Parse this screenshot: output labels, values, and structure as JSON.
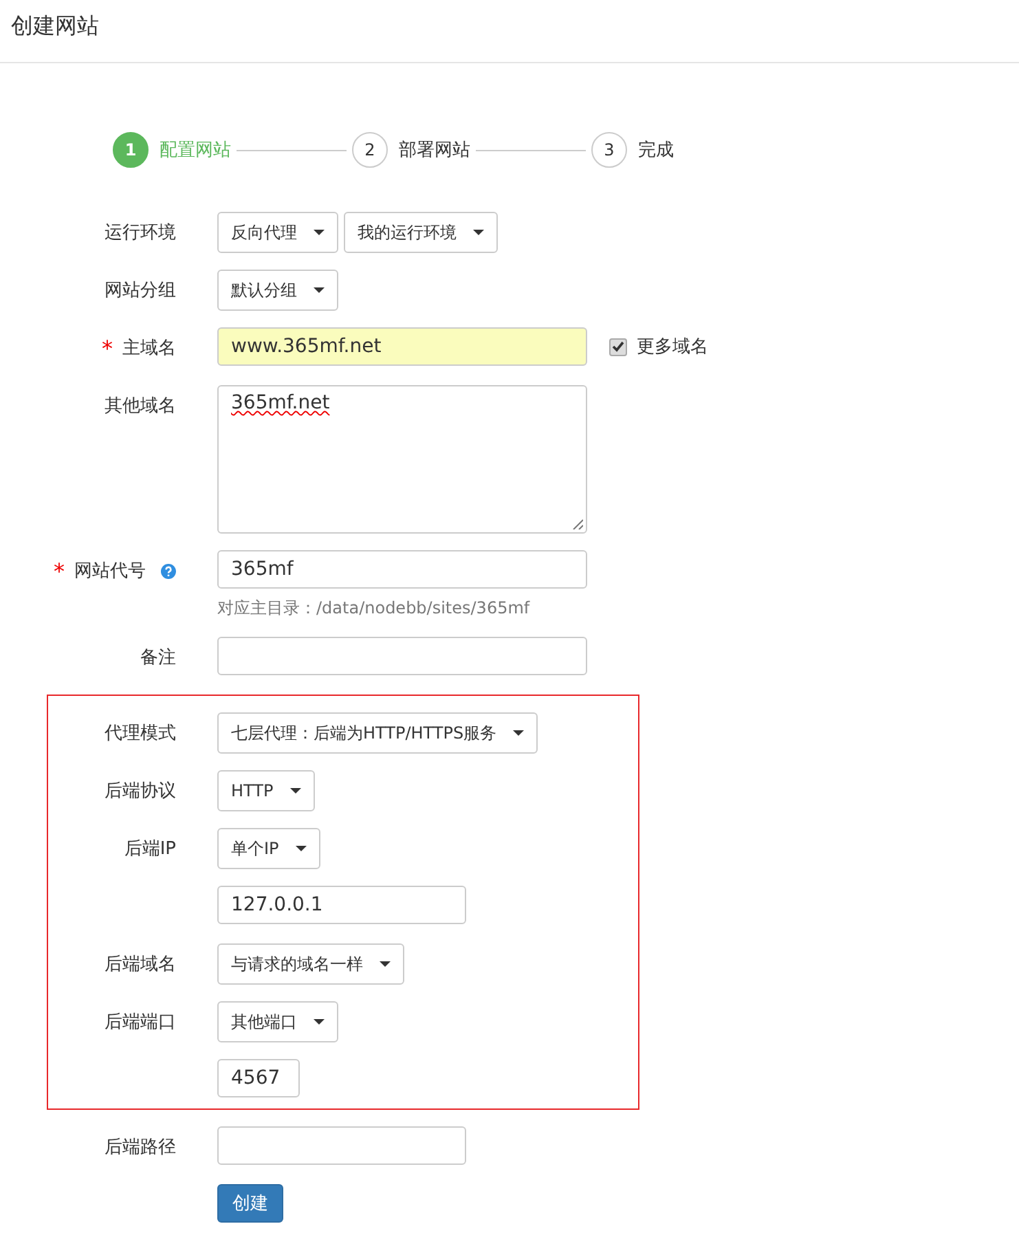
{
  "page_title": "创建网站",
  "steps": [
    {
      "number": "1",
      "label": "配置网站",
      "selected": true
    },
    {
      "number": "2",
      "label": "部署网站",
      "selected": false
    },
    {
      "number": "3",
      "label": "完成",
      "selected": false
    }
  ],
  "sections": [
    {
      "highlighted": false,
      "rows": [
        {
          "kind": "select",
          "label": "运行环境",
          "selects": [
            "反向代理",
            "我的运行环境"
          ]
        },
        {
          "kind": "select",
          "label": "网站分组",
          "selects": [
            "默认分组"
          ]
        },
        {
          "kind": "wide-input",
          "label": "主域名",
          "required_mark": "*",
          "value": "www.365mf.net",
          "autofilled": true,
          "checkbox": {
            "label": "更多域名",
            "checked": true
          }
        },
        {
          "kind": "textarea",
          "label": "其他域名",
          "value": "365mf.net"
        },
        {
          "kind": "wide-input",
          "label": "网站代号",
          "required_mark": "*",
          "help": true,
          "value": "365mf",
          "hint": "对应主目录：/data/nodebb/sites/365mf"
        },
        {
          "kind": "wide-input",
          "label": "备注"
        }
      ]
    },
    {
      "highlighted": true,
      "rows": [
        {
          "kind": "select",
          "label": "代理模式",
          "selects": [
            "七层代理：后端为HTTP/HTTPS服务"
          ]
        },
        {
          "kind": "select",
          "label": "后端协议",
          "selects": [
            "HTTP"
          ]
        },
        {
          "kind": "select",
          "label": "后端IP",
          "selects": [
            "单个IP"
          ]
        },
        {
          "kind": "medium-input",
          "value": "127.0.0.1"
        },
        {
          "kind": "select",
          "label": "后端域名",
          "selects": [
            "与请求的域名一样"
          ]
        },
        {
          "kind": "select",
          "label": "后端端口",
          "selects": [
            "其他端口"
          ]
        },
        {
          "kind": "short-input",
          "value": "4567"
        }
      ]
    },
    {
      "highlighted": false,
      "rows": [
        {
          "kind": "medium-input",
          "label": "后端路径"
        }
      ]
    }
  ],
  "submit_button": "创建"
}
